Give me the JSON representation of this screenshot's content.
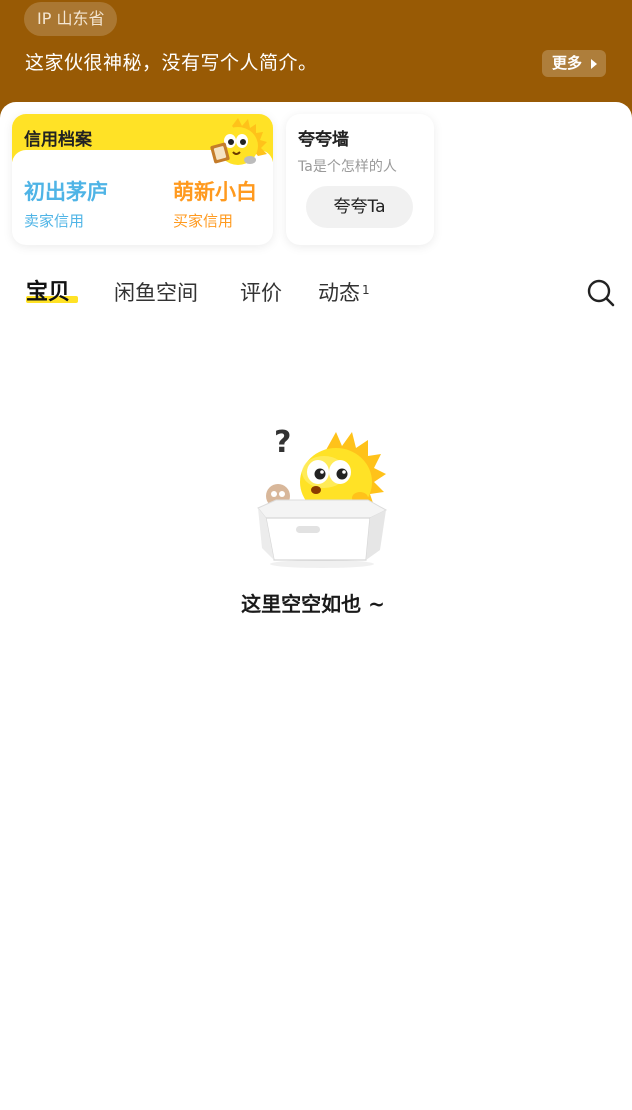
{
  "header": {
    "ip_location": "IP 山东省",
    "bio": "这家伙很神秘，没有写个人简介。",
    "more_label": "更多"
  },
  "credit": {
    "title": "信用档案",
    "seller_level": "初出茅庐",
    "seller_label": "卖家信用",
    "buyer_level": "萌新小白",
    "buyer_label": "买家信用"
  },
  "praise": {
    "title": "夸夸墙",
    "subtitle": "Ta是个怎样的人",
    "button_label": "夸夸Ta"
  },
  "tabs": [
    {
      "label": "宝贝",
      "active": true
    },
    {
      "label": "闲鱼空间",
      "active": false
    },
    {
      "label": "评价",
      "active": false
    },
    {
      "label": "动态",
      "badge": "1",
      "active": false
    }
  ],
  "empty": {
    "message": "这里空空如也 ~"
  },
  "colors": {
    "header_bg": "#985a05",
    "accent_yellow": "#ffe226",
    "seller_blue": "#4fb4e6",
    "buyer_orange": "#ff9a1f"
  },
  "icons": {
    "search": "search-icon",
    "more_arrow": "triangle-right-icon",
    "mascot": "fish-mascot-icon"
  }
}
